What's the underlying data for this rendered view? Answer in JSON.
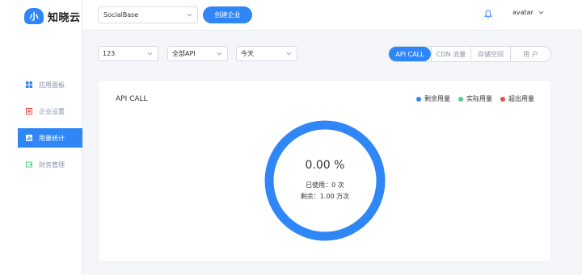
{
  "logo": {
    "mark": "小",
    "name": "知晓云"
  },
  "sidebar": {
    "items": [
      {
        "label": "应用面板",
        "icon": "dashboard-icon",
        "active": false
      },
      {
        "label": "企业设置",
        "icon": "settings-icon",
        "active": false
      },
      {
        "label": "用量统计",
        "icon": "stats-icon",
        "active": true
      },
      {
        "label": "财务管理",
        "icon": "finance-icon",
        "active": false
      }
    ]
  },
  "header": {
    "company": "SocialBase",
    "create_label": "创建企业",
    "user": "avatar"
  },
  "filters": {
    "app": "123",
    "api": "全部API",
    "period": "今天"
  },
  "tabs": [
    {
      "label": "API CALL",
      "active": true
    },
    {
      "label": "CDN 流量",
      "active": false
    },
    {
      "label": "存储空间",
      "active": false
    },
    {
      "label": "用 户",
      "active": false
    }
  ],
  "card": {
    "title": "API CALL",
    "legend": [
      {
        "label": "剩余用量",
        "color": "#2f86f6"
      },
      {
        "label": "实际用量",
        "color": "#4cd28a"
      },
      {
        "label": "超出用量",
        "color": "#f04b4b"
      }
    ],
    "percent": "0.00 %",
    "used": "已使用：0 次",
    "remaining": "剩余：1.00 万次",
    "progress_fraction": 0.0
  },
  "colors": {
    "accent": "#2f86f6"
  }
}
